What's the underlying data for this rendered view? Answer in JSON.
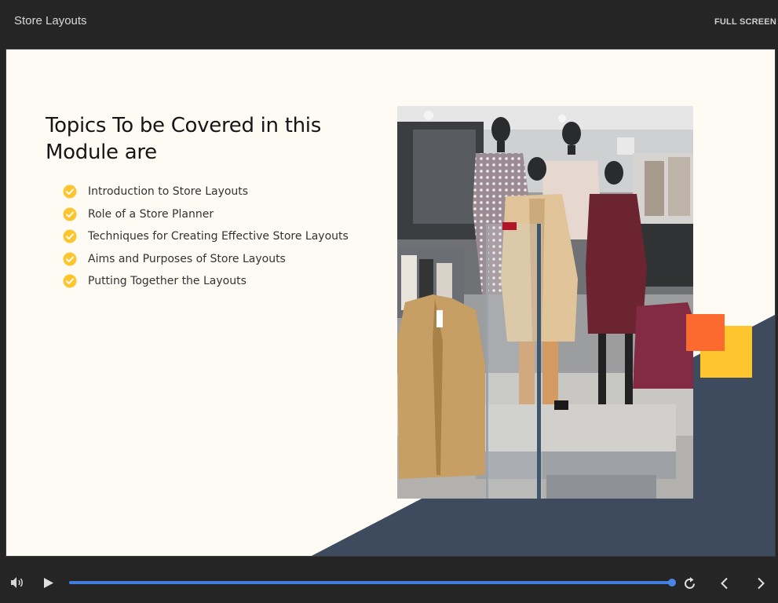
{
  "window": {
    "title": "Store Layouts",
    "fullscreen_label": "FULL SCREEN"
  },
  "slide": {
    "heading": "Topics To be Covered in this Module are",
    "topics": [
      "Introduction to Store Layouts",
      "Role of a Store Planner",
      "Techniques for Creating Effective Store Layouts",
      "Aims and Purposes of Store Layouts",
      "Putting Together the Layouts"
    ],
    "check_icon": "check-circle-icon",
    "photo_subject": "store-photo",
    "colors": {
      "background": "#fefbf5",
      "navy_shape": "#3e4a5d",
      "accent_yellow": "#fec52e",
      "accent_orange": "#fd6a2f",
      "check": "#fec52e"
    }
  },
  "player": {
    "progress_fraction": 1.0,
    "icons": {
      "volume": "volume-icon",
      "play": "play-icon",
      "replay": "replay-icon",
      "prev": "chevron-left-icon",
      "next": "chevron-right-icon"
    },
    "colors": {
      "track": "#5b6f8f",
      "fill": "#3f7de0"
    }
  }
}
